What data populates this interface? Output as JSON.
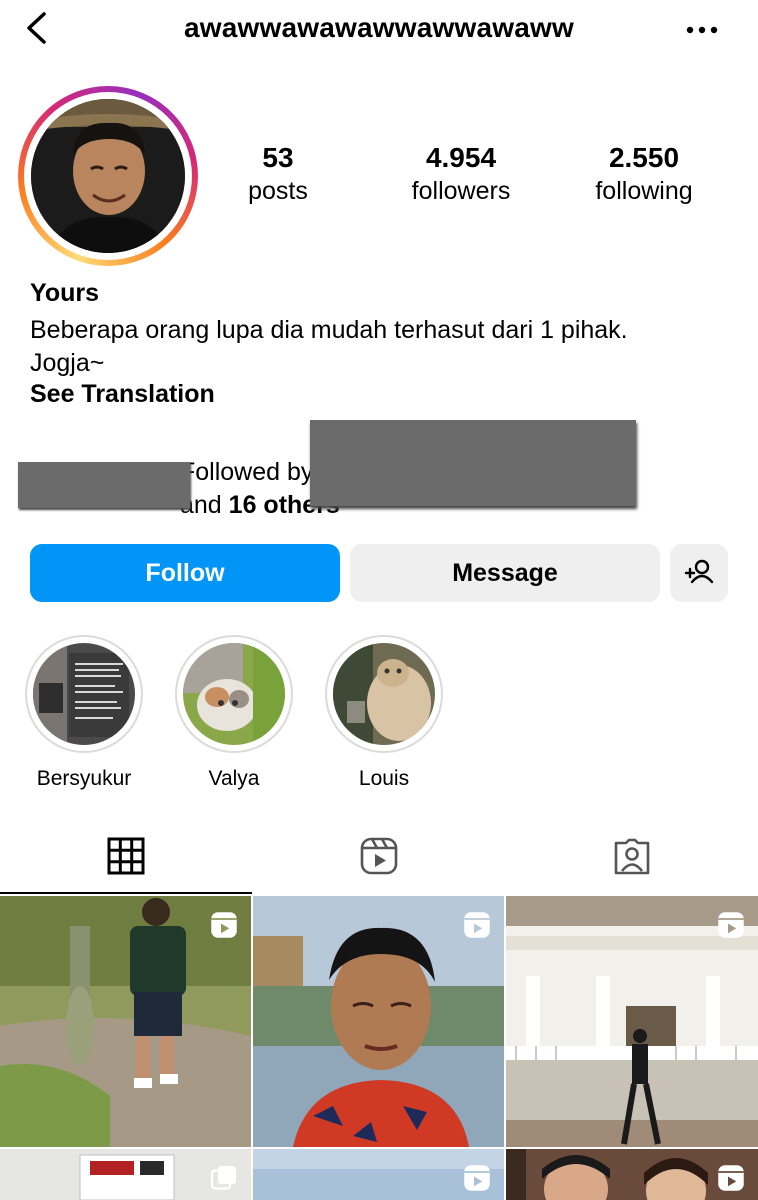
{
  "header": {
    "username": "awawwawawawwawwawaww",
    "back_icon": "chevron-left-icon",
    "more_icon": "more-horizontal-icon"
  },
  "profile": {
    "stats": [
      {
        "value": "53",
        "label": "posts"
      },
      {
        "value": "4.954",
        "label": "followers"
      },
      {
        "value": "2.550",
        "label": "following"
      }
    ],
    "name": "Yours",
    "bio_line1": "Beberapa orang lupa dia mudah terhasut dari 1 pihak.",
    "bio_line2": "Jogja~",
    "see_translation": "See Translation",
    "followed_by_prefix": "Followed by",
    "followed_by_and": "and",
    "followed_by_others": "16 others"
  },
  "actions": {
    "follow_label": "Follow",
    "message_label": "Message",
    "add_user_icon": "add-user-icon",
    "follow_color": "#0095f6"
  },
  "highlights": [
    {
      "label": "Bersyukur"
    },
    {
      "label": "Valya"
    },
    {
      "label": "Louis"
    }
  ],
  "tabs": [
    {
      "icon": "grid-icon",
      "active": true
    },
    {
      "icon": "reels-icon",
      "active": false
    },
    {
      "icon": "tagged-icon",
      "active": false
    }
  ]
}
